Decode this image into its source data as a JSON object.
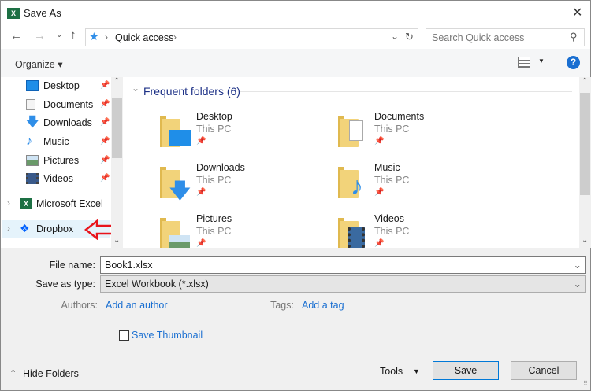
{
  "window": {
    "title": "Save As"
  },
  "nav": {
    "breadcrumb": "Quick access",
    "search_placeholder": "Search Quick access"
  },
  "toolbar": {
    "organize": "Organize ▾",
    "help": "?"
  },
  "sidebar": {
    "items": [
      {
        "label": "Desktop"
      },
      {
        "label": "Documents"
      },
      {
        "label": "Downloads"
      },
      {
        "label": "Music"
      },
      {
        "label": "Pictures"
      },
      {
        "label": "Videos"
      }
    ],
    "groups": [
      {
        "label": "Microsoft Excel"
      },
      {
        "label": "Dropbox"
      }
    ]
  },
  "main": {
    "section_title": "Frequent folders (6)",
    "folders": [
      {
        "name": "Desktop",
        "location": "This PC"
      },
      {
        "name": "Documents",
        "location": "This PC"
      },
      {
        "name": "Downloads",
        "location": "This PC"
      },
      {
        "name": "Music",
        "location": "This PC"
      },
      {
        "name": "Pictures",
        "location": "This PC"
      },
      {
        "name": "Videos",
        "location": "This PC"
      }
    ]
  },
  "form": {
    "file_name_label": "File name:",
    "file_name": "Book1.xlsx",
    "type_label": "Save as type:",
    "type_value": "Excel Workbook (*.xlsx)",
    "authors_label": "Authors:",
    "authors_link": "Add an author",
    "tags_label": "Tags:",
    "tags_link": "Add a tag",
    "thumbnail_label": "Save Thumbnail"
  },
  "footer": {
    "hide_folders": "Hide Folders",
    "tools": "Tools",
    "save": "Save",
    "cancel": "Cancel"
  },
  "colors": {
    "accent": "#1a6fd1",
    "annotation": "#e8141c"
  }
}
